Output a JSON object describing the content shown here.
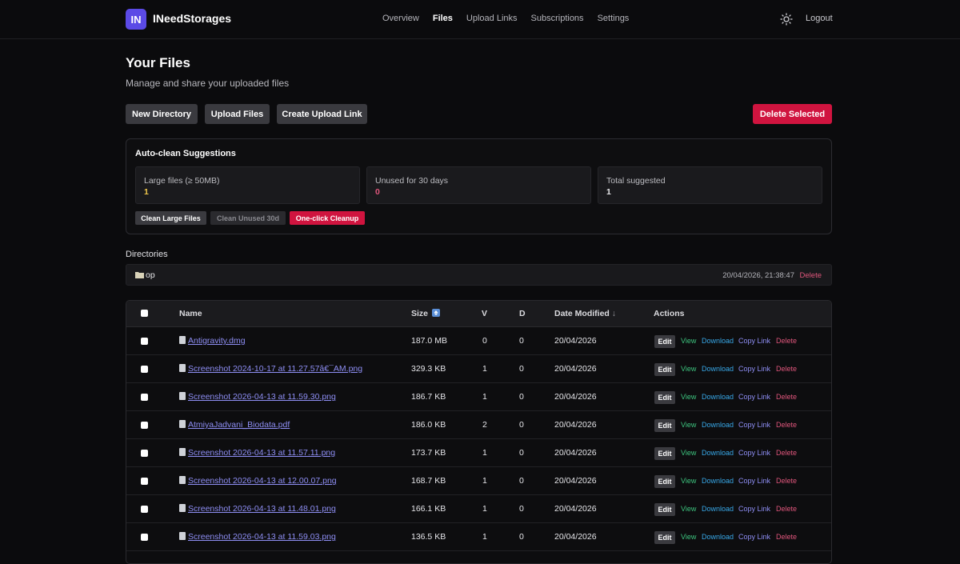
{
  "header": {
    "logo": "IN",
    "brand": "INeedStorages",
    "nav": [
      "Overview",
      "Files",
      "Upload Links",
      "Subscriptions",
      "Settings"
    ],
    "active_nav": "Files",
    "logout": "Logout",
    "theme_icon": "sun-icon"
  },
  "page": {
    "title": "Your Files",
    "subtitle": "Manage and share your uploaded files"
  },
  "toolbar": {
    "new_directory": "New Directory",
    "upload_files": "Upload Files",
    "create_upload_link": "Create Upload Link",
    "delete_selected": "Delete Selected"
  },
  "autoclean": {
    "title": "Auto-clean Suggestions",
    "stats": [
      {
        "label": "Large files (≥ 50MB)",
        "value": "1",
        "color": "#f2c94c"
      },
      {
        "label": "Unused for 30 days",
        "value": "0",
        "color": "#e0567c"
      },
      {
        "label": "Total suggested",
        "value": "1",
        "color": "#e8e8ea"
      }
    ],
    "buttons": {
      "clean_large": "Clean Large Files",
      "clean_unused": "Clean Unused 30d",
      "one_click": "One-click Cleanup"
    }
  },
  "directories": {
    "label": "Directories",
    "items": [
      {
        "name": "op",
        "date": "20/04/2026, 21:38:47",
        "delete": "Delete"
      }
    ]
  },
  "table": {
    "columns": {
      "name": "Name",
      "size": "Size",
      "v": "V",
      "d": "D",
      "date": "Date Modified",
      "actions": "Actions"
    },
    "actions": {
      "edit": "Edit",
      "view": "View",
      "download": "Download",
      "copy": "Copy Link",
      "delete": "Delete"
    },
    "rows": [
      {
        "name": "Antigravity.dmg",
        "size": "187.0 MB",
        "v": "0",
        "d": "0",
        "date": "20/04/2026"
      },
      {
        "name": "Screenshot 2024-10-17 at 11.27.57â€¯AM.png",
        "size": "329.3 KB",
        "v": "1",
        "d": "0",
        "date": "20/04/2026"
      },
      {
        "name": "Screenshot 2026-04-13 at 11.59.30.png",
        "size": "186.7 KB",
        "v": "1",
        "d": "0",
        "date": "20/04/2026"
      },
      {
        "name": "AtmiyaJadvani_Biodata.pdf",
        "size": "186.0 KB",
        "v": "2",
        "d": "0",
        "date": "20/04/2026"
      },
      {
        "name": "Screenshot 2026-04-13 at 11.57.11.png",
        "size": "173.7 KB",
        "v": "1",
        "d": "0",
        "date": "20/04/2026"
      },
      {
        "name": "Screenshot 2026-04-13 at 12.00.07.png",
        "size": "168.7 KB",
        "v": "1",
        "d": "0",
        "date": "20/04/2026"
      },
      {
        "name": "Screenshot 2026-04-13 at 11.48.01.png",
        "size": "166.1 KB",
        "v": "1",
        "d": "0",
        "date": "20/04/2026"
      },
      {
        "name": "Screenshot 2026-04-13 at 11.59.03.png",
        "size": "136.5 KB",
        "v": "1",
        "d": "0",
        "date": "20/04/2026"
      }
    ]
  }
}
